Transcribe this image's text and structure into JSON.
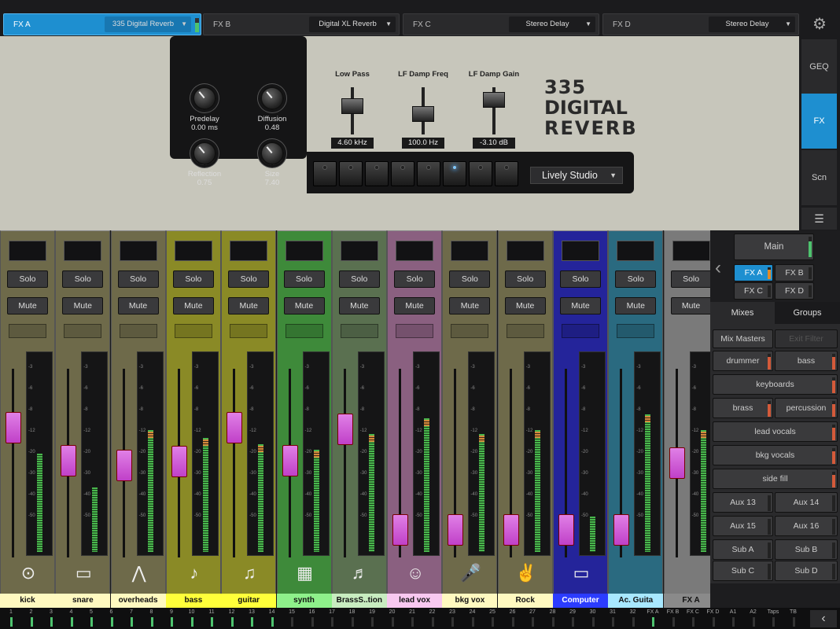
{
  "fx_tabs": [
    {
      "label": "FX A",
      "preset": "335 Digital Reverb",
      "active": true
    },
    {
      "label": "FX B",
      "preset": "Digital XL Reverb",
      "active": false
    },
    {
      "label": "FX C",
      "preset": "Stereo Delay",
      "active": false
    },
    {
      "label": "FX D",
      "preset": "Stereo Delay",
      "active": false
    }
  ],
  "plugin": {
    "knobs": [
      {
        "name": "Predelay",
        "value": "0.00 ms"
      },
      {
        "name": "Diffusion",
        "value": "0.48"
      },
      {
        "name": "Reflection",
        "value": "0.75"
      },
      {
        "name": "Size",
        "value": "7.40"
      }
    ],
    "faders": [
      {
        "name": "Low Pass",
        "value": "4.60 kHz"
      },
      {
        "name": "LF Damp Freq",
        "value": "100.0 Hz"
      },
      {
        "name": "LF Damp Gain",
        "value": "-3.10 dB"
      }
    ],
    "preset": "Lively Studio",
    "logo": [
      "335",
      "DIGITAL",
      "REVERB"
    ]
  },
  "right_nav": [
    "GEQ",
    "FX",
    "Scn"
  ],
  "channel": {
    "solo": "Solo",
    "mute": "Mute"
  },
  "channels": [
    {
      "name": "kick",
      "color": "#6e6a4a",
      "label_bg": "#fff9c0",
      "icon": "drum-icon",
      "glyph": "⊙",
      "level": 0.5
    },
    {
      "name": "snare",
      "color": "#6e6a4a",
      "label_bg": "#fff9c0",
      "icon": "snare-icon",
      "glyph": "▭",
      "level": 0.33
    },
    {
      "name": "overheads",
      "color": "#6e6a4a",
      "label_bg": "#fff9c0",
      "icon": "cymbals-icon",
      "glyph": "⋀",
      "level": 0.62
    },
    {
      "name": "bass",
      "color": "#8a8a26",
      "label_bg": "#ffff3a",
      "icon": "bass-guitar-icon",
      "glyph": "♪",
      "level": 0.58
    },
    {
      "name": "guitar",
      "color": "#8a8a26",
      "label_bg": "#ffff3a",
      "icon": "guitar-icon",
      "glyph": "♫",
      "level": 0.55
    },
    {
      "name": "synth",
      "color": "#3e8a3a",
      "label_bg": "#8ef08a",
      "icon": "keyboard-icon",
      "glyph": "▦",
      "level": 0.52
    },
    {
      "name": "BrassS..tion",
      "color": "#5a7050",
      "label_bg": "#c8ecc0",
      "icon": "trumpet-icon",
      "glyph": "♬",
      "level": 0.6
    },
    {
      "name": "lead vox",
      "color": "#8a6080",
      "label_bg": "#f8c8f0",
      "icon": "singer-icon",
      "glyph": "☺",
      "level": 0.68
    },
    {
      "name": "bkg vox",
      "color": "#6e6a4a",
      "label_bg": "#fff9c0",
      "icon": "microphone-icon",
      "glyph": "🎤",
      "level": 0.6
    },
    {
      "name": "Rock",
      "color": "#6e6a4a",
      "label_bg": "#fff9c0",
      "icon": "rock-hand-icon",
      "glyph": "✌",
      "level": 0.62
    },
    {
      "name": "Computer",
      "color": "#24249a",
      "label_bg": "#2b3cff",
      "icon": "laptop-icon",
      "glyph": "▭",
      "level": 0.18
    },
    {
      "name": "Ac. Guita",
      "color": "#2a6a80",
      "label_bg": "#a8e8ff",
      "icon": "acoustic-guitar-icon",
      "glyph": "",
      "level": 0.7
    },
    {
      "name": "FX A",
      "color": "#7a7a7a",
      "label_bg": "#8a8a8a",
      "icon": "",
      "glyph": "",
      "level": 0.62
    }
  ],
  "mix": {
    "main": "Main",
    "fx": [
      "FX A",
      "FX B",
      "FX C",
      "FX D"
    ],
    "tabs": [
      "Mixes",
      "Groups"
    ],
    "mix_masters": "Mix Masters",
    "exit_filter": "Exit Filter",
    "buttons": [
      "drummer",
      "bass",
      "keyboards",
      "brass",
      "percussion",
      "lead vocals",
      "bkg vocals",
      "side fill",
      "Aux 13",
      "Aux 14",
      "Aux 15",
      "Aux 16",
      "Sub A",
      "Sub B",
      "Sub C",
      "Sub D"
    ]
  },
  "bottom": [
    "1",
    "2",
    "3",
    "4",
    "5",
    "6",
    "7",
    "8",
    "9",
    "10",
    "11",
    "12",
    "13",
    "14",
    "15",
    "16",
    "17",
    "18",
    "19",
    "20",
    "21",
    "22",
    "23",
    "24",
    "25",
    "26",
    "27",
    "28",
    "29",
    "30",
    "31",
    "32",
    "FX A",
    "FX B",
    "FX C",
    "FX D",
    "A1",
    "A2",
    "Taps",
    "TB"
  ]
}
